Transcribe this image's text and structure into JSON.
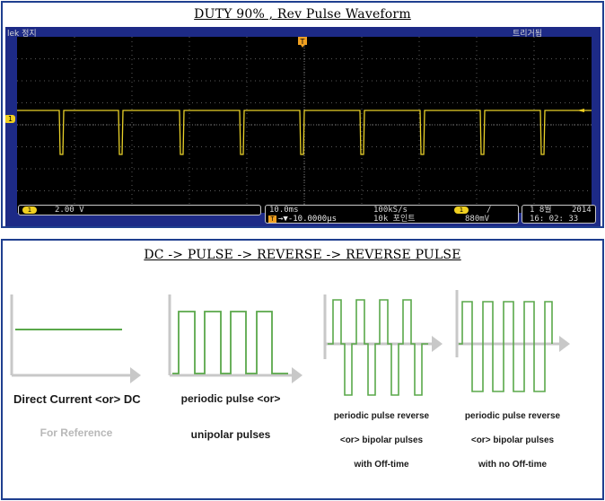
{
  "panel1": {
    "title": "DUTY 90% , Rev Pulse Waveform"
  },
  "scope": {
    "brand": "lek 정지",
    "trigger_status": "트리거됨",
    "trigger_marker": "T",
    "ch1_marker": "1",
    "ch1_badge": "1",
    "ch1_scale": "2.00 V",
    "timebase": "10.0ms",
    "sample_rate": "100kS/s",
    "record_length": "10k 포인트",
    "delay": "→▼-10.0000µs",
    "trig_badge": "1",
    "trig_slope": "/",
    "trig_level": "880mV",
    "date_day": "1 8월",
    "date_year": "2014",
    "time": "16: 02: 33",
    "colors": {
      "trace": "#e8d028",
      "grid": "#5a5a5a",
      "frame": "#1d2a86"
    }
  },
  "panel2": {
    "title": "DC -> PULSE -> REVERSE -> REVERSE PULSE",
    "figures": [
      {
        "line1": "Direct Current <or> DC",
        "line2": "For Reference",
        "line3": ""
      },
      {
        "line1": "periodic pulse <or>",
        "line2": "unipolar pulses",
        "line3": ""
      },
      {
        "line1": "periodic pulse reverse",
        "line2": "<or> bipolar pulses",
        "line3": "with Off-time"
      },
      {
        "line1": "periodic pulse reverse",
        "line2": "<or> bipolar pulses",
        "line3": "with no Off-time"
      }
    ],
    "colors": {
      "wave": "#5aa84a",
      "axis": "#c8c8c8"
    }
  }
}
